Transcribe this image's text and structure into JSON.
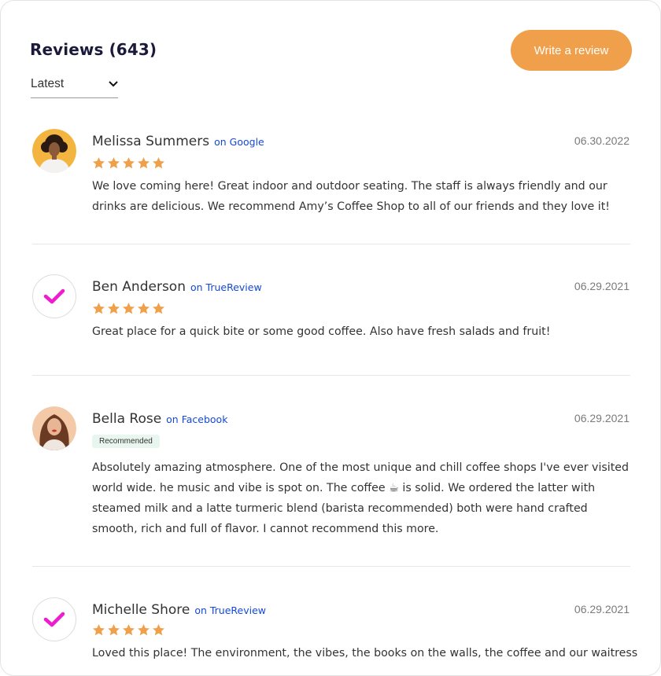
{
  "header": {
    "title": "Reviews (643)",
    "write_button": "Write a review",
    "sort_selected": "Latest"
  },
  "colors": {
    "accent": "#f0a04a",
    "star": "#f0a04a",
    "source_link": "#1349d6",
    "check_mark": "#ee1bd0",
    "badge_bg": "#e9f6ef"
  },
  "reviews": [
    {
      "name": "Melissa Summers",
      "source": "on Google",
      "date": "06.30.2022",
      "rating": 5,
      "avatar": "photo-woman-curly-hair",
      "text": "We love coming here! Great indoor and outdoor seating. The staff is always friendly and our drinks are delicious. We recommend Amy’s Coffee Shop to all of our friends and they love it!"
    },
    {
      "name": "Ben Anderson",
      "source": "on TrueReview",
      "date": "06.29.2021",
      "rating": 5,
      "avatar": "check-icon",
      "text": "Great place for a quick bite or some good coffee. Also have fresh salads and fruit!"
    },
    {
      "name": "Bella Rose",
      "source": "on Facebook",
      "date": "06.29.2021",
      "badge": "Recommended",
      "avatar": "photo-woman-long-hair",
      "text": "Absolutely amazing atmosphere. One of the most unique and chill coffee shops I've ever visited world wide. he music and vibe is spot on. The coffee ☕  is solid. We ordered the latter with steamed milk and a latte turmeric blend (barista recommended) both were  hand crafted smooth, rich and full of flavor. I cannot recommend this more."
    },
    {
      "name": "Michelle Shore",
      "source": "on TrueReview",
      "date": "06.29.2021",
      "rating": 5,
      "avatar": "check-icon",
      "text": "Loved this place! The environment, the vibes, the books on the walls,  the coffee and our waitress"
    }
  ]
}
